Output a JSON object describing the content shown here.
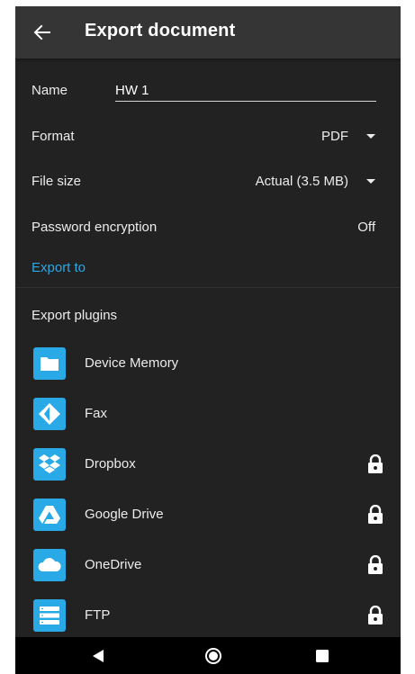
{
  "appbar": {
    "title": "Export document",
    "back_icon": "arrow-left-icon"
  },
  "form": {
    "name_label": "Name",
    "name_value": "HW 1",
    "format_label": "Format",
    "format_value": "PDF",
    "filesize_label": "File size",
    "filesize_value": "Actual (3.5 MB)",
    "password_label": "Password encryption",
    "password_value": "Off"
  },
  "export_to": {
    "label": "Export to"
  },
  "plugins": {
    "header": "Export plugins",
    "items": [
      {
        "label": "Device Memory",
        "icon": "folder-icon",
        "locked": false
      },
      {
        "label": "Fax",
        "icon": "fax-icon",
        "locked": false
      },
      {
        "label": "Dropbox",
        "icon": "dropbox-icon",
        "locked": true
      },
      {
        "label": "Google Drive",
        "icon": "google-drive-icon",
        "locked": true
      },
      {
        "label": "OneDrive",
        "icon": "onedrive-icon",
        "locked": true
      },
      {
        "label": "FTP",
        "icon": "ftp-server-icon",
        "locked": true
      }
    ]
  },
  "navbar": {
    "back_icon": "nav-back-icon",
    "home_icon": "nav-home-icon",
    "recents_icon": "nav-recents-icon"
  },
  "colors": {
    "background": "#222222",
    "appbar": "#353535",
    "accent": "#29a9e6",
    "text": "#ececec"
  }
}
